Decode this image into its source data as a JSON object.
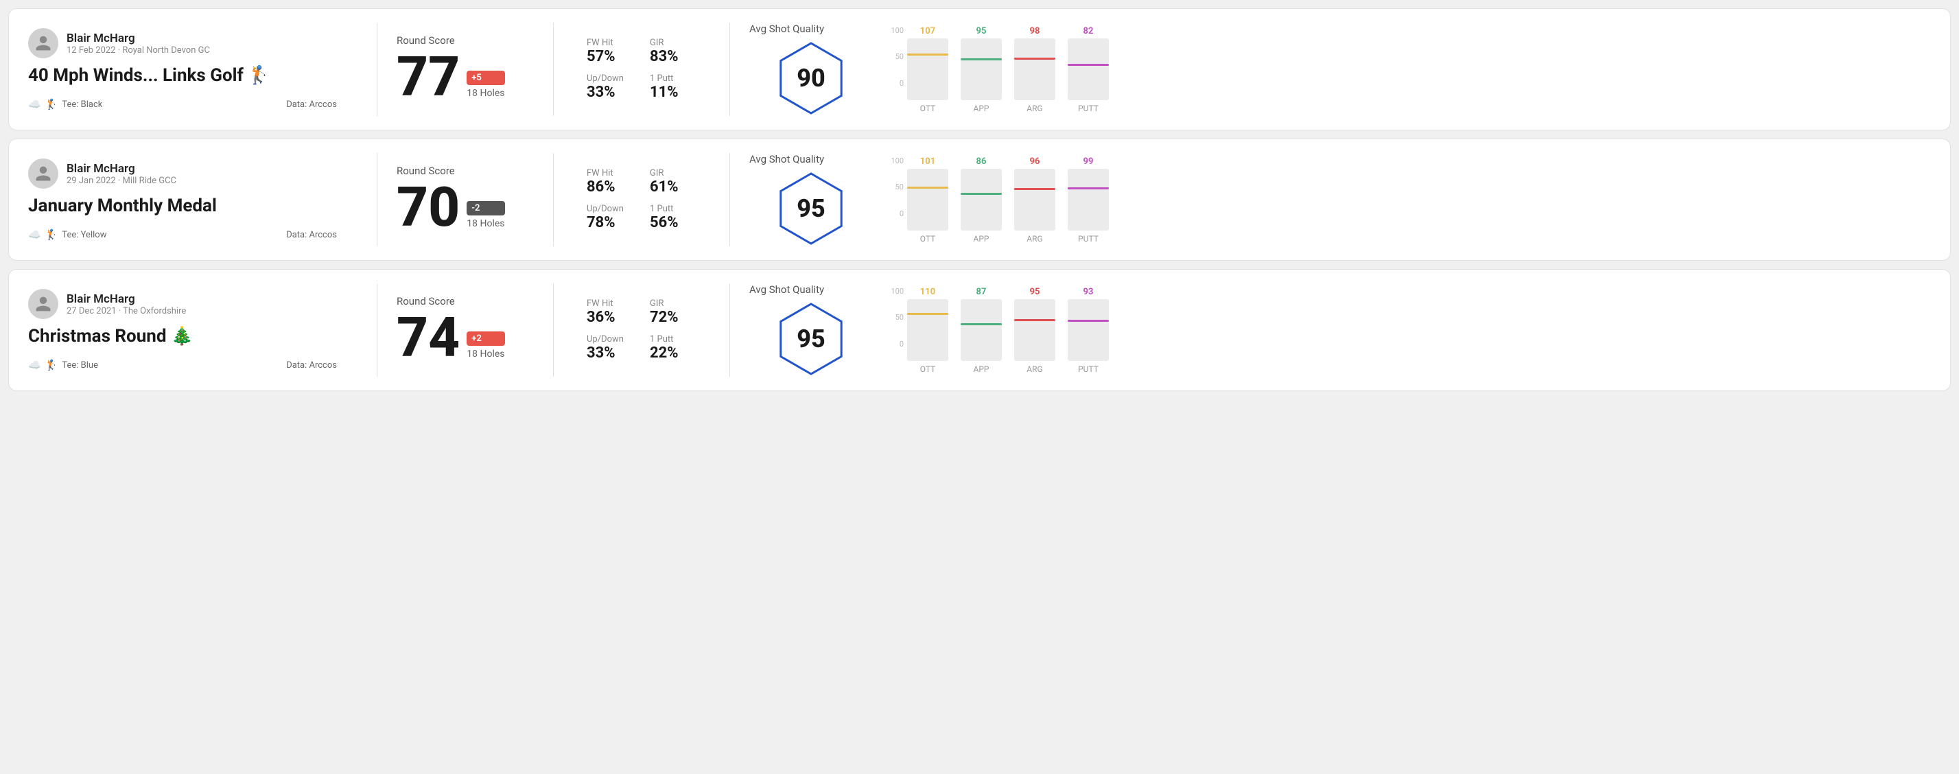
{
  "rounds": [
    {
      "id": "round1",
      "user": {
        "name": "Blair McHarg",
        "meta": "12 Feb 2022 · Royal North Devon GC"
      },
      "title": "40 Mph Winds... Links Golf 🏌️",
      "tee": "Black",
      "data_source": "Data: Arccos",
      "score": {
        "value": "77",
        "modifier": "+5",
        "modifier_type": "positive",
        "holes": "18 Holes"
      },
      "stats": {
        "fw_hit_label": "FW Hit",
        "fw_hit_value": "57%",
        "gir_label": "GIR",
        "gir_value": "83%",
        "updown_label": "Up/Down",
        "updown_value": "33%",
        "putt1_label": "1 Putt",
        "putt1_value": "11%"
      },
      "quality": {
        "label": "Avg Shot Quality",
        "score": "90"
      },
      "chart": {
        "columns": [
          {
            "label": "OTT",
            "value": 107,
            "color": "#e8b84b",
            "bar_pct": 72
          },
          {
            "label": "APP",
            "value": 95,
            "color": "#4caf7d",
            "bar_pct": 64
          },
          {
            "label": "ARG",
            "value": 98,
            "color": "#e05050",
            "bar_pct": 66
          },
          {
            "label": "PUTT",
            "value": 82,
            "color": "#c050c0",
            "bar_pct": 55
          }
        ]
      }
    },
    {
      "id": "round2",
      "user": {
        "name": "Blair McHarg",
        "meta": "29 Jan 2022 · Mill Ride GCC"
      },
      "title": "January Monthly Medal",
      "tee": "Yellow",
      "data_source": "Data: Arccos",
      "score": {
        "value": "70",
        "modifier": "-2",
        "modifier_type": "negative",
        "holes": "18 Holes"
      },
      "stats": {
        "fw_hit_label": "FW Hit",
        "fw_hit_value": "86%",
        "gir_label": "GIR",
        "gir_value": "61%",
        "updown_label": "Up/Down",
        "updown_value": "78%",
        "putt1_label": "1 Putt",
        "putt1_value": "56%"
      },
      "quality": {
        "label": "Avg Shot Quality",
        "score": "95"
      },
      "chart": {
        "columns": [
          {
            "label": "OTT",
            "value": 101,
            "color": "#e8b84b",
            "bar_pct": 68
          },
          {
            "label": "APP",
            "value": 86,
            "color": "#4caf7d",
            "bar_pct": 58
          },
          {
            "label": "ARG",
            "value": 96,
            "color": "#e05050",
            "bar_pct": 65
          },
          {
            "label": "PUTT",
            "value": 99,
            "color": "#c050c0",
            "bar_pct": 67
          }
        ]
      }
    },
    {
      "id": "round3",
      "user": {
        "name": "Blair McHarg",
        "meta": "27 Dec 2021 · The Oxfordshire"
      },
      "title": "Christmas Round 🎄",
      "tee": "Blue",
      "data_source": "Data: Arccos",
      "score": {
        "value": "74",
        "modifier": "+2",
        "modifier_type": "positive",
        "holes": "18 Holes"
      },
      "stats": {
        "fw_hit_label": "FW Hit",
        "fw_hit_value": "36%",
        "gir_label": "GIR",
        "gir_value": "72%",
        "updown_label": "Up/Down",
        "updown_value": "33%",
        "putt1_label": "1 Putt",
        "putt1_value": "22%"
      },
      "quality": {
        "label": "Avg Shot Quality",
        "score": "95"
      },
      "chart": {
        "columns": [
          {
            "label": "OTT",
            "value": 110,
            "color": "#e8b84b",
            "bar_pct": 74
          },
          {
            "label": "APP",
            "value": 87,
            "color": "#4caf7d",
            "bar_pct": 58
          },
          {
            "label": "ARG",
            "value": 95,
            "color": "#e05050",
            "bar_pct": 64
          },
          {
            "label": "PUTT",
            "value": 93,
            "color": "#c050c0",
            "bar_pct": 63
          }
        ]
      }
    }
  ]
}
